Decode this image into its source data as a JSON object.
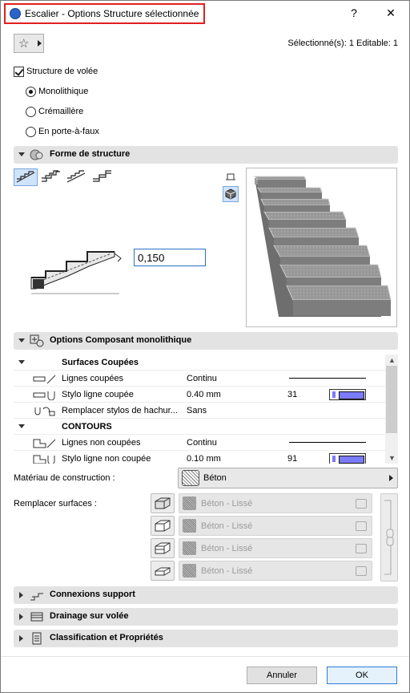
{
  "window": {
    "title": "Escalier - Options Structure sélectionnée",
    "help_label": "?",
    "close_label": "✕"
  },
  "header": {
    "favorites_icon": "star-icon",
    "selection_info": "Sélectionné(s): 1 Editable: 1"
  },
  "structure": {
    "checkbox_label": "Structure de volée",
    "checked": true,
    "options": [
      {
        "label": "Monolithique",
        "selected": true
      },
      {
        "label": "Crémaillère",
        "selected": false
      },
      {
        "label": "En porte-à-faux",
        "selected": false
      }
    ]
  },
  "forme": {
    "section_label": "Forme de structure",
    "thickness_value": "0,150"
  },
  "composant": {
    "section_label": "Options Composant monolithique",
    "groups": [
      {
        "label": "Surfaces Coupées",
        "rows": [
          {
            "label": "Lignes coupées",
            "value": "Continu",
            "pen": ""
          },
          {
            "label": "Stylo ligne coupée",
            "value": "0.40 mm",
            "pen": "31"
          },
          {
            "label": "Remplacer stylos de hachur...",
            "value": "Sans",
            "pen": ""
          }
        ]
      },
      {
        "label": "CONTOURS",
        "rows": [
          {
            "label": "Lignes non coupées",
            "value": "Continu",
            "pen": ""
          },
          {
            "label": "Stylo ligne non coupée",
            "value": "0.10 mm",
            "pen": "91"
          }
        ]
      }
    ]
  },
  "materiau": {
    "label": "Matériau de construction :",
    "value": "Béton"
  },
  "surfaces": {
    "label": "Remplacer surfaces :",
    "items": [
      "Béton - Lissé",
      "Béton - Lissé",
      "Béton - Lissé",
      "Béton - Lissé"
    ]
  },
  "collapsed_sections": [
    "Connexions support",
    "Drainage sur volée",
    "Classification et Propriétés"
  ],
  "footer": {
    "cancel_label": "Annuler",
    "ok_label": "OK"
  }
}
